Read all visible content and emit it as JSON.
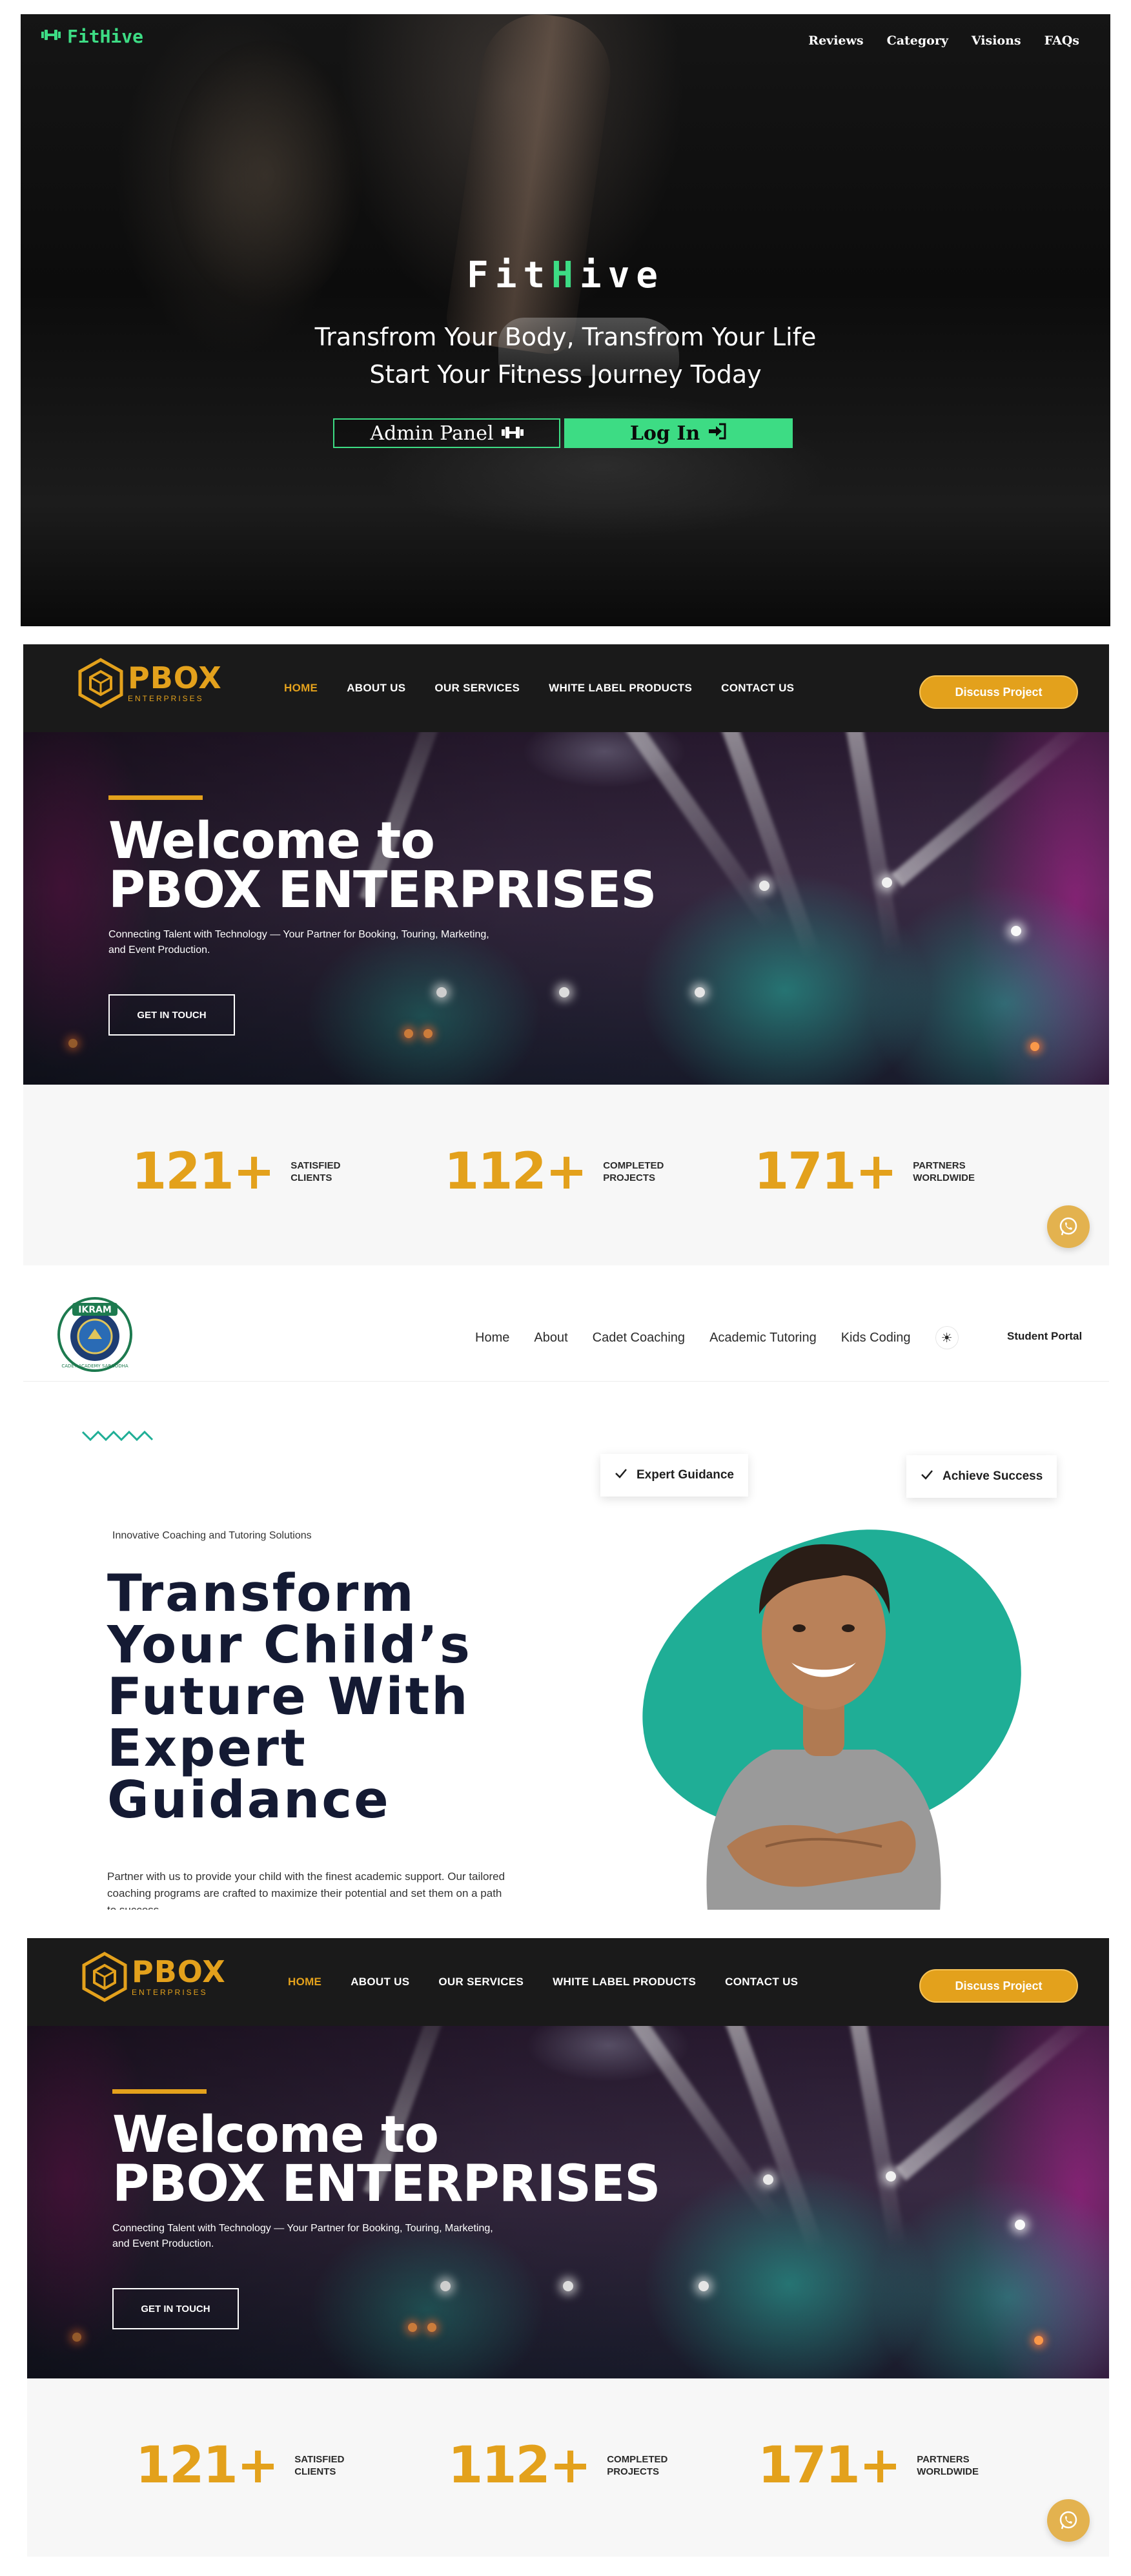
{
  "fithive": {
    "brand": "FitHive",
    "logo_icon": "dumbbell-icon",
    "nav": [
      "Reviews",
      "Category",
      "Visions",
      "FAQs"
    ],
    "title_pre": "Fit",
    "title_accent": "H",
    "title_post": "ive",
    "subtitle_line1": "Transfrom Your Body, Transfrom Your Life",
    "subtitle_line2": "Start Your Fitness Journey Today",
    "admin_button": "Admin Panel",
    "admin_icon": "dumbbell-icon",
    "login_button": "Log In",
    "login_icon": "sign-in-icon",
    "colors": {
      "accent": "#3ddc84",
      "background": "#050505"
    }
  },
  "pbox": {
    "logo_name": "PBOX",
    "logo_sub": "ENTERPRISES",
    "nav": [
      "HOME",
      "ABOUT US",
      "OUR SERVICES",
      "WHITE LABEL PRODUCTS",
      "CONTACT US"
    ],
    "active_nav": "HOME",
    "cta": "Discuss Project",
    "hero_line1": "Welcome to",
    "hero_line2": "PBOX ENTERPRISES",
    "hero_desc": "Connecting Talent with Technology — Your Partner for Booking, Touring, Marketing, and Event Production.",
    "hero_button": "GET IN TOUCH",
    "stats": [
      {
        "value": "121+",
        "label_line1": "SATISFIED",
        "label_line2": "CLIENTS"
      },
      {
        "value": "112+",
        "label_line1": "COMPLETED",
        "label_line2": "PROJECTS"
      },
      {
        "value": "171+",
        "label_line1": "PARTNERS",
        "label_line2": "WORLDWIDE"
      }
    ],
    "whatsapp_icon": "whatsapp-icon",
    "colors": {
      "accent": "#e3a11c",
      "header": "#1a1a1a"
    }
  },
  "ikram": {
    "seal_text": "IKRAM",
    "seal_ring": "CADET ACADEMY SARGODHA",
    "nav": [
      "Home",
      "About",
      "Cadet Coaching",
      "Academic Tutoring",
      "Kids Coding"
    ],
    "theme_icon": "sun-icon",
    "portal": "Student Portal",
    "eyebrow": "Innovative Coaching and Tutoring Solutions",
    "headline": [
      "Transform",
      "Your Child’s",
      "Future With",
      "Expert",
      "Guidance"
    ],
    "paragraph": "Partner with us to provide your child with the finest academic support. Our tailored coaching programs are crafted to maximize their potential and set them on a path to success.",
    "chip_1": "Expert Guidance",
    "chip_2": "Achieve Success",
    "colors": {
      "accent": "#1fae96",
      "headline": "#141a33"
    }
  }
}
